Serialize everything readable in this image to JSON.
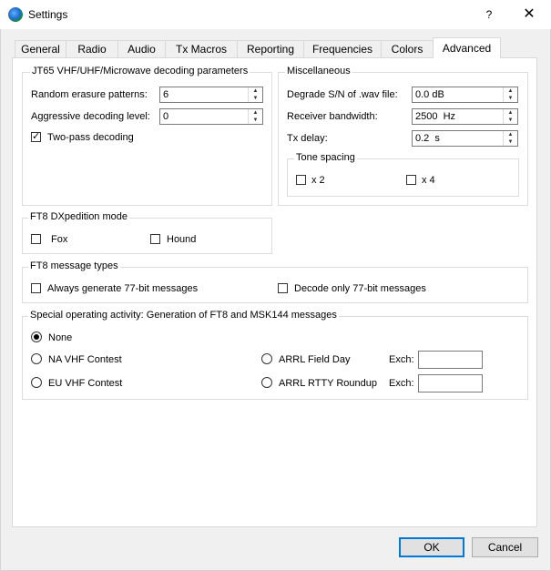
{
  "window": {
    "title": "Settings",
    "help_label": "?",
    "close_label": "✕"
  },
  "tabs": [
    {
      "label": "General"
    },
    {
      "label": "Radio"
    },
    {
      "label": "Audio"
    },
    {
      "label": "Tx Macros"
    },
    {
      "label": "Reporting"
    },
    {
      "label": "Frequencies"
    },
    {
      "label": "Colors"
    },
    {
      "label": "Advanced",
      "active": true
    }
  ],
  "jt65": {
    "title": "JT65 VHF/UHF/Microwave decoding parameters",
    "random_erasure_label": "Random erasure patterns:",
    "random_erasure_value": "6",
    "aggressive_label": "Aggressive decoding level:",
    "aggressive_value": "0",
    "two_pass_label": "Two-pass decoding",
    "two_pass_checked": true
  },
  "misc": {
    "title": "Miscellaneous",
    "degrade_label": "Degrade S/N of .wav file:",
    "degrade_value": "0.0 dB",
    "bandwidth_label": "Receiver bandwidth:",
    "bandwidth_value": "2500  Hz",
    "txdelay_label": "Tx delay:",
    "txdelay_value": "0.2  s",
    "tone_spacing": {
      "title": "Tone spacing",
      "x2_label": "x 2",
      "x4_label": "x 4"
    }
  },
  "dxpedition": {
    "title": "FT8 DXpedition mode",
    "fox_label": "Fox",
    "hound_label": "Hound"
  },
  "msgtypes": {
    "title": "FT8 message types",
    "always77_label": "Always generate 77-bit messages",
    "decode77_label": "Decode only 77-bit messages"
  },
  "special": {
    "title": "Special operating activity:  Generation of FT8 and MSK144 messages",
    "none_label": "None",
    "na_vhf_label": "NA VHF Contest",
    "eu_vhf_label": "EU VHF Contest",
    "arrl_field_label": "ARRL Field Day",
    "arrl_rtty_label": "ARRL RTTY Roundup",
    "exch_label": "Exch:",
    "exch1_value": "",
    "exch2_value": ""
  },
  "buttons": {
    "ok_label": "OK",
    "cancel_label": "Cancel"
  },
  "spin_up_glyph": "▲",
  "spin_down_glyph": "▼"
}
